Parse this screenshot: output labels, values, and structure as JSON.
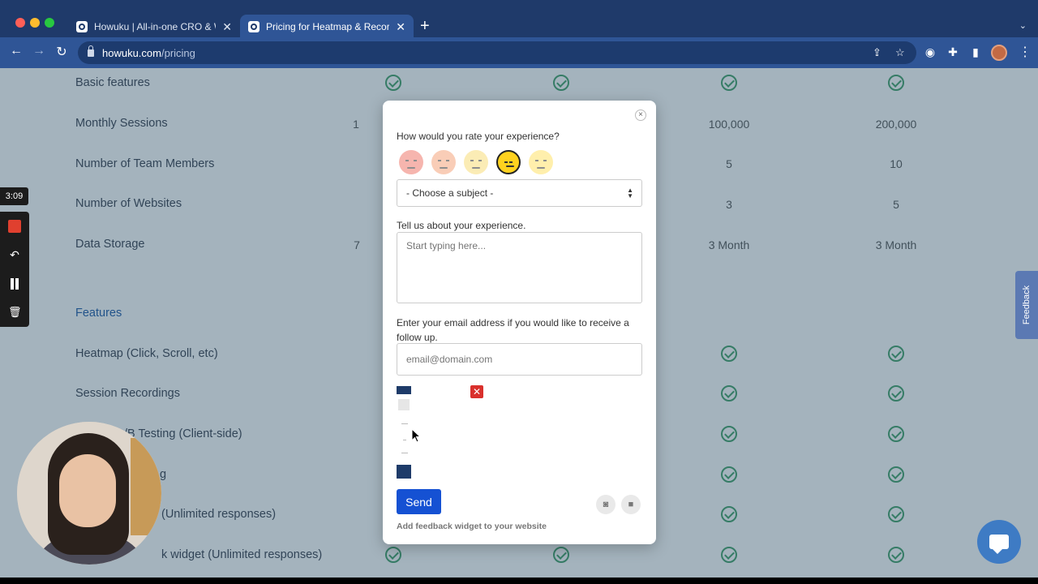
{
  "browser": {
    "tabs": [
      {
        "title": "Howuku | All-in-one CRO & We",
        "active": false
      },
      {
        "title": "Pricing for Heatmap & Recordir",
        "active": true
      }
    ],
    "new_tab": "+",
    "url_host": "howuku.com",
    "url_path": "/pricing"
  },
  "pricing": {
    "rows": [
      {
        "label": "Basic features",
        "cells": [
          "check",
          "check",
          "check",
          "check"
        ]
      },
      {
        "label": "Monthly Sessions",
        "cells": [
          "1",
          "",
          "100,000",
          "200,000"
        ]
      },
      {
        "label": "Number of Team Members",
        "cells": [
          "",
          "",
          "5",
          "10"
        ]
      },
      {
        "label": "Number of Websites",
        "cells": [
          "",
          "",
          "3",
          "5"
        ]
      },
      {
        "label": "Data Storage",
        "cells": [
          "7",
          "",
          "3 Month",
          "3 Month"
        ]
      }
    ],
    "features_heading": "Features",
    "feature_rows": [
      {
        "label": "Heatmap (Click, Scroll, etc)"
      },
      {
        "label": "Session Recordings"
      },
      {
        "label": "/B Testing (Client-side)"
      },
      {
        "label": "g"
      },
      {
        "label": "(Unlimited responses)"
      },
      {
        "label": "k widget (Unlimited responses)"
      }
    ]
  },
  "feedback_tab_label": "Feedback",
  "modal": {
    "close_glyph": "×",
    "rating_question": "How would you rate your experience?",
    "rating_selected": 4,
    "rating_max": 5,
    "subject_select": "- Choose a subject -",
    "experience_label": "Tell us about your experience.",
    "experience_placeholder": "Start typing here...",
    "email_label": "Enter your email address if you would like to receive a follow up.",
    "email_placeholder": "email@domain.com",
    "send_label": "Send",
    "powered_text": "Add feedback widget to your website"
  },
  "recorder": {
    "time": "3:09"
  },
  "colors": {
    "accent": "#1551d3",
    "check": "#42a16a",
    "chrome": "#2f5596"
  }
}
